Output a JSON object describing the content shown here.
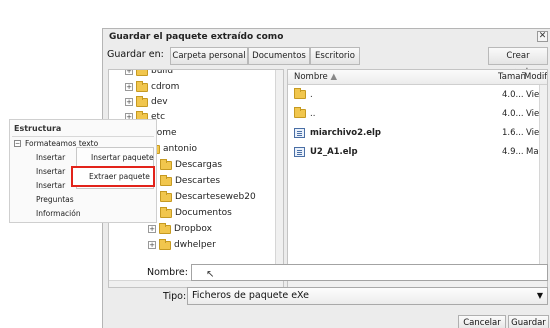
{
  "dialog": {
    "title": "Guardar el paquete extraído como",
    "close_label": "✕",
    "save_in_label": "Guardar en:",
    "path_buttons": [
      "Carpeta personal",
      "Documentos",
      "Escritorio"
    ],
    "create_folder_label": "Crear carpeta",
    "tree": [
      {
        "label": "build"
      },
      {
        "label": "cdrom"
      },
      {
        "label": "dev"
      },
      {
        "label": "etc"
      },
      {
        "label": "home"
      },
      {
        "label": "antonio"
      },
      {
        "label": "Descargas"
      },
      {
        "label": "Descartes"
      },
      {
        "label": "Descarteseweb20"
      },
      {
        "label": "Documentos"
      },
      {
        "label": "Dropbox"
      },
      {
        "label": "dwhelper"
      }
    ],
    "files": {
      "columns": {
        "name": "Nombre",
        "size": "Tamañ",
        "modified": "Modifi"
      },
      "rows": [
        {
          "name": ".",
          "size": "4.0...",
          "modified": "Vie..."
        },
        {
          "name": "..",
          "size": "4.0...",
          "modified": "Vie..."
        },
        {
          "name": "miarchivo2.elp",
          "size": "1.6...",
          "modified": "Vie..."
        },
        {
          "name": "U2_A1.elp",
          "size": "4.9...",
          "modified": "Ma..."
        }
      ]
    },
    "name_label": "Nombre:",
    "name_value": "",
    "type_label": "Tipo:",
    "type_value": "Ficheros de paquete eXe",
    "cancel_label": "Cancelar",
    "save_label": "Guardar"
  },
  "estructura": {
    "title": "Estructura",
    "root": "Formateamos texto",
    "items": [
      "Insertar",
      "Insertar",
      "Insertar",
      "Preguntas",
      "Información"
    ],
    "context_menu": {
      "insert": "Insertar paquete",
      "extract": "Extraer paquete"
    }
  },
  "colors": {
    "highlight_border": "#e2231a",
    "folder": "#f1c64d"
  }
}
